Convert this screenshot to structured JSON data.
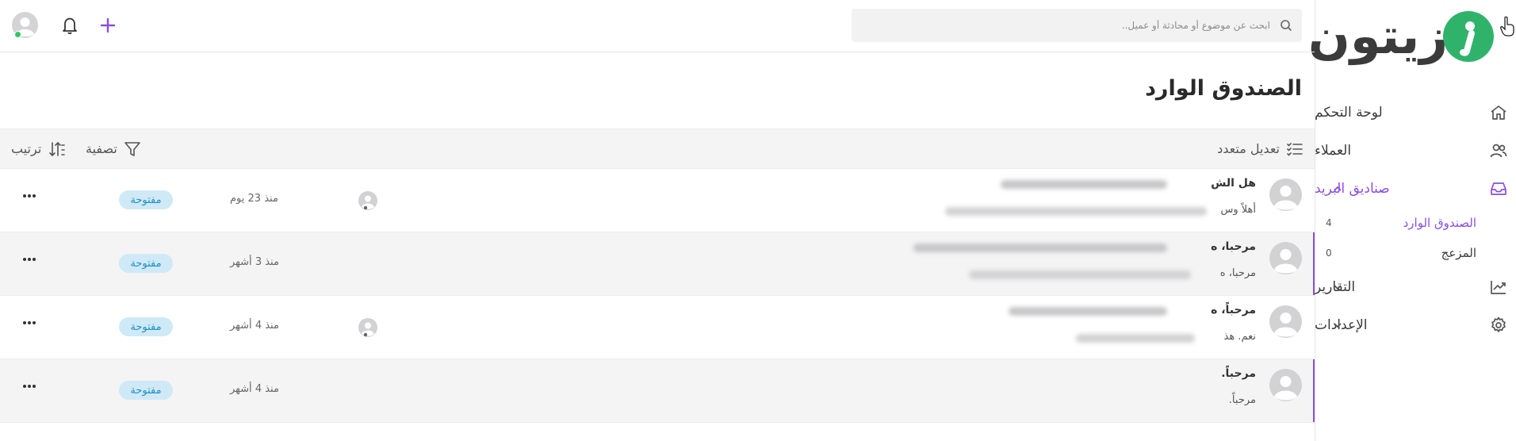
{
  "app": {
    "logo_text": "زيتون",
    "brand_color": "#2fb36b",
    "accent_color": "#8a4ee0"
  },
  "topbar": {
    "search_placeholder": "ابحث عن موضوع أو محادثة أو عميل..",
    "search_icon": "search-icon",
    "plus_icon": "plus-icon",
    "bell_icon": "bell-icon",
    "avatar_status": "online"
  },
  "sidebar": {
    "items": [
      {
        "label": "لوحة التحكم",
        "icon": "home-icon"
      },
      {
        "label": "العملاء",
        "icon": "users-icon"
      },
      {
        "label": "صناديق البريد",
        "icon": "inbox-icon",
        "expanded": true
      },
      {
        "label": "التقارير",
        "icon": "chart-icon"
      },
      {
        "label": "الإعدادات",
        "icon": "gear-icon"
      }
    ],
    "subitems": [
      {
        "label": "الصندوق الوارد",
        "count": "4"
      },
      {
        "label": "المزعج",
        "count": "0"
      }
    ]
  },
  "main": {
    "title": "الصندوق الوارد",
    "toolbar": {
      "bulk_edit": "تعديل متعدد",
      "filter": "تصفية",
      "sort": "ترتيب"
    },
    "conversations": [
      {
        "subject": "هل الش",
        "preview": "أهلاً وس",
        "time": "منذ 23 يوم",
        "status": "مفتوحة",
        "has_agent": true
      },
      {
        "subject": "مرحبا، ه",
        "preview": "مرحبا، ه",
        "time": "منذ 3 أشهر",
        "status": "مفتوحة",
        "has_agent": false
      },
      {
        "subject": "مرحباً، ه",
        "preview": "نعم. هذ",
        "time": "منذ 4 أشهر",
        "status": "مفتوحة",
        "has_agent": true
      },
      {
        "subject": "مرحباً.",
        "preview": "مرحباً.",
        "time": "منذ 4 أشهر",
        "status": "مفتوحة",
        "has_agent": false
      }
    ]
  }
}
